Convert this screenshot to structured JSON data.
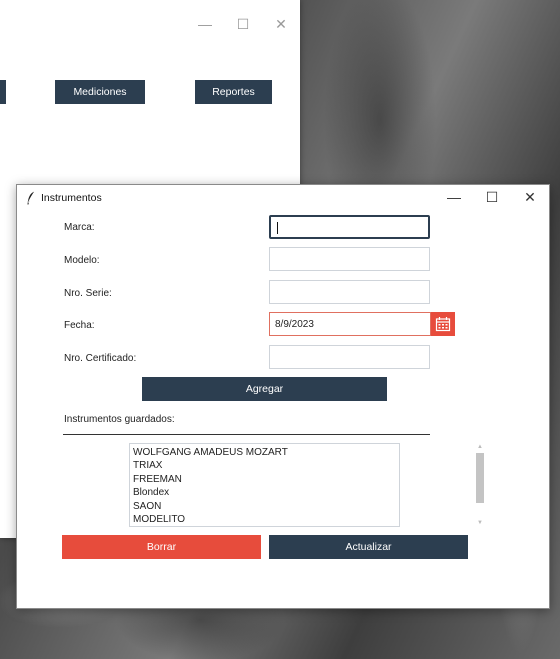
{
  "back_window": {
    "nav_buttons": [
      {
        "label": ""
      },
      {
        "label": "Mediciones"
      },
      {
        "label": "Reportes"
      }
    ]
  },
  "window": {
    "title": "Instrumentos",
    "controls": {
      "minimize": "—",
      "maximize": "☐",
      "close": "✕"
    }
  },
  "form": {
    "marca": {
      "label": "Marca:",
      "value": ""
    },
    "modelo": {
      "label": "Modelo:",
      "value": ""
    },
    "serie": {
      "label": "Nro. Serie:",
      "value": ""
    },
    "fecha": {
      "label": "Fecha:",
      "value": "8/9/2023"
    },
    "certificado": {
      "label": "Nro. Certificado:",
      "value": ""
    }
  },
  "buttons": {
    "agregar": "Agregar",
    "borrar": "Borrar",
    "actualizar": "Actualizar"
  },
  "list": {
    "label": "Instrumentos guardados:",
    "items": [
      "WOLFGANG AMADEUS MOZART",
      "TRIAX",
      "FREEMAN",
      "Blondex",
      "SAON",
      "MODELITO"
    ]
  },
  "icons": {
    "calendar": "calendar-icon",
    "feather": "feather-icon"
  },
  "colors": {
    "primary": "#2c3e50",
    "danger": "#e74c3c"
  }
}
